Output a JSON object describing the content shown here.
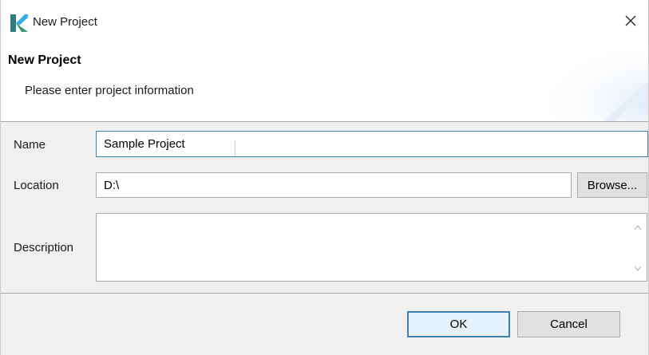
{
  "window": {
    "title": "New Project",
    "close_glyph": "✕"
  },
  "banner": {
    "title": "New Project",
    "subtitle": "Please enter project information"
  },
  "form": {
    "name_label": "Name",
    "name_value": "Sample Project",
    "location_label": "Location",
    "location_value": "D:\\",
    "browse_label": "Browse...",
    "description_label": "Description",
    "description_value": ""
  },
  "buttons": {
    "ok_label": "OK",
    "cancel_label": "Cancel"
  },
  "colors": {
    "focus_border": "#3c7fb1",
    "logo_primary": "#2f7d7a",
    "logo_accent": "#35b0e0"
  },
  "icons": {
    "app_logo": "app-logo-icon",
    "close": "close-icon",
    "scroll_up": "chevron-up-icon",
    "scroll_down": "chevron-down-icon"
  }
}
